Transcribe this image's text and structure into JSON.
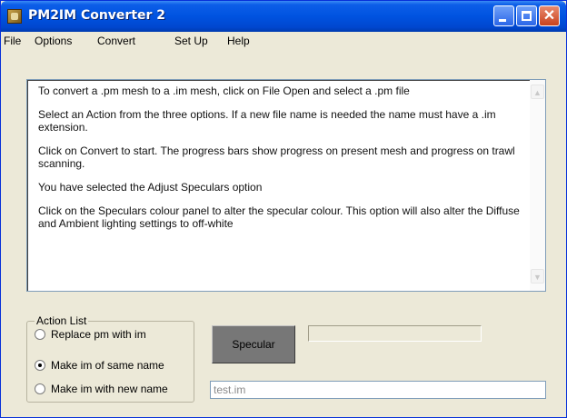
{
  "window": {
    "title": "PM2IM Converter 2",
    "close_glyph": "✕"
  },
  "menu": {
    "items": [
      "File",
      "Options",
      "Convert",
      "Set Up",
      "Help"
    ]
  },
  "instructions": {
    "paragraphs": [
      "To convert a .pm mesh to a .im mesh, click on File Open and select a .pm file",
      "Select an Action from the three options. If a new file name is needed the name must have a .im extension.",
      "Click on Convert to start. The progress bars show progress on present mesh and progress on trawl scanning.",
      "You have selected the Adjust Speculars option",
      "Click on the Speculars colour panel to alter the specular colour.  This option will also alter the Diffuse and Ambient lighting settings to off-white"
    ]
  },
  "action_list": {
    "label": "Action List",
    "options": [
      "Replace pm with im",
      "Make im of same name",
      "Make im with new name"
    ],
    "selected": "Make im of same name"
  },
  "specular": {
    "label": "Specular",
    "color": "#777777"
  },
  "progress": {
    "value": 0
  },
  "filename": {
    "value": "test.im"
  },
  "icons": [
    "app-icon",
    "minimize-icon",
    "maximize-icon",
    "close-icon",
    "scroll-up-arrow-icon",
    "scroll-down-arrow-icon"
  ]
}
